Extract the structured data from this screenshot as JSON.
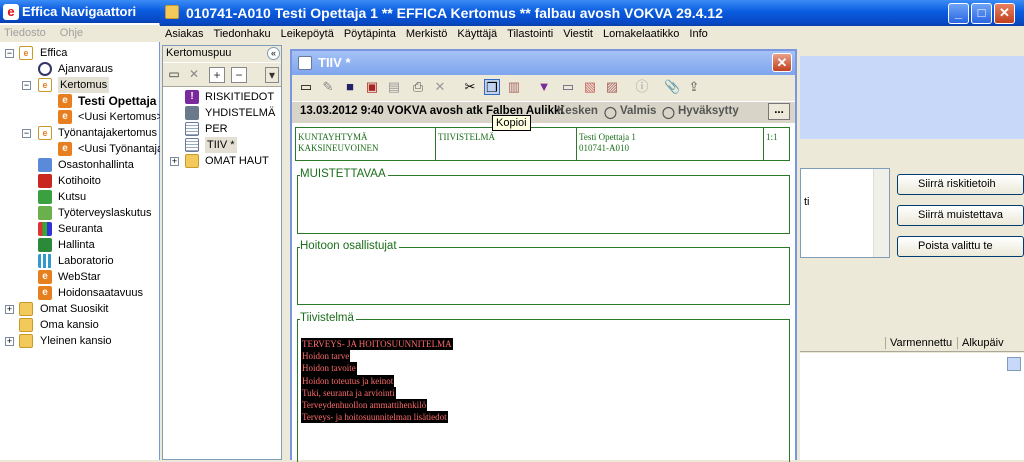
{
  "left_window": {
    "title": "Effica Navigaattori",
    "menu": [
      "Tiedosto",
      "Ohje"
    ],
    "tree": [
      {
        "label": "Effica",
        "icon": "folder-effica-icon"
      },
      {
        "label": "Ajanvaraus",
        "icon": "clock-icon"
      },
      {
        "label": "Kertomus",
        "icon": "folder-effica-icon"
      },
      {
        "label": "Testi Opettaja",
        "icon": "effica-e-icon"
      },
      {
        "label": "<Uusi Kertomus>",
        "icon": "effica-e-icon"
      },
      {
        "label": "Työnantajakertomus",
        "icon": "folder-effica-icon"
      },
      {
        "label": "<Uusi Työnantaja",
        "icon": "effica-e-icon"
      },
      {
        "label": "Osastonhallinta",
        "icon": "bed-icon"
      },
      {
        "label": "Kotihoito",
        "icon": "house-icon"
      },
      {
        "label": "Kutsu",
        "icon": "mail-icon"
      },
      {
        "label": "Työterveyslaskutus",
        "icon": "invoice-icon"
      },
      {
        "label": "Seuranta",
        "icon": "chart-icon"
      },
      {
        "label": "Hallinta",
        "icon": "people-icon"
      },
      {
        "label": "Laboratorio",
        "icon": "test-tubes-icon"
      },
      {
        "label": "WebStar",
        "icon": "web-e-icon"
      },
      {
        "label": "Hoidonsaatavuus",
        "icon": "web-e-icon"
      },
      {
        "label": "Omat Suosikit",
        "icon": "folder-icon"
      },
      {
        "label": "Oma kansio",
        "icon": "folder-icon"
      },
      {
        "label": "Yleinen kansio",
        "icon": "folder-icon"
      }
    ]
  },
  "main_window": {
    "title": "010741-A010  Testi Opettaja 1  ** EFFICA Kertomus **  falbau avosh  VOKVA  29.4.12",
    "menu": [
      "Asiakas",
      "Tiedonhaku",
      "Leikepöytä",
      "Pöytäpinta",
      "Merkistö",
      "Käyttäjä",
      "Tilastointi",
      "Viestit",
      "Lomakelaatikko",
      "Info"
    ]
  },
  "kertomuspuu": {
    "header": "Kertomuspuu",
    "items": [
      {
        "label": "RISKITIEDOT",
        "icon": "warning-shield-icon"
      },
      {
        "label": "YHDISTELMÄ",
        "icon": "people-icon"
      },
      {
        "label": "PER",
        "icon": "document-icon"
      },
      {
        "label": "TIIV *",
        "icon": "document-icon"
      },
      {
        "label": "OMAT HAUT",
        "icon": "folder-icon"
      }
    ]
  },
  "dialog": {
    "title": "TIIV *",
    "infobar": "13.03.2012 9:40 VOKVA avosh atk Falben Aulikki",
    "status_items": [
      "Kesken",
      "Valmis",
      "Hyväksytty"
    ],
    "more_label": "...",
    "tooltip": "Kopioi",
    "header_table": {
      "col1": [
        "KUNTAYHTYMÄ",
        "KAKSINEUVOINEN"
      ],
      "col2": "TIIVISTELMÄ",
      "col3": [
        "Testi Opettaja 1",
        "010741-A010"
      ],
      "col4": "1:1"
    },
    "sections": {
      "muistettavaa": "MUISTETTAVAA",
      "hoitoon": "Hoitoon osallistujat",
      "tiivistelma": "Tiivistelmä"
    },
    "tiivistelma_lines": [
      "TERVEYS- JA HOITOSUUNNITELMA",
      "Hoidon tarve",
      "Hoidon tavoite",
      "Hoidon toteutus ja keinot",
      "Tuki, seuranta ja arviointi",
      "Terveydenhuollon ammattihenkilö",
      "Terveys- ja hoitosuunnitelman lisätiedot"
    ]
  },
  "right_panel": {
    "buttons": [
      "Siirrä riskitietoih",
      "Siirrä muistettava",
      "Poista valittu te"
    ],
    "fragment": "ti",
    "grid_headers": [
      "Varmennettu",
      "Alkupäiv"
    ]
  },
  "colors": {
    "title_blue": "#0a5ce0",
    "form_green": "#2a7a2a",
    "highlight_red": "#ff6a6a"
  }
}
